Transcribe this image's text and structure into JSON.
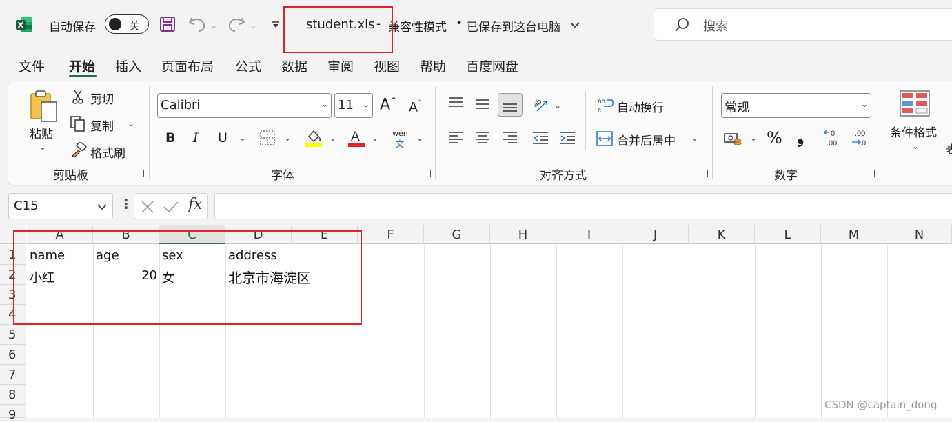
{
  "titlebar": {
    "autosave_label": "自动保存",
    "autosave_state": "关",
    "filename": "student.xls",
    "separator": "-",
    "mode": "兼容性模式",
    "save_status": "已保存到这台电脑",
    "search_placeholder": "搜索"
  },
  "menu": [
    "文件",
    "开始",
    "插入",
    "页面布局",
    "公式",
    "数据",
    "审阅",
    "视图",
    "帮助",
    "百度网盘"
  ],
  "ribbon": {
    "clipboard": {
      "paste": "粘贴",
      "cut": "剪切",
      "copy": "复制",
      "format_painter": "格式刷",
      "group": "剪贴板"
    },
    "font": {
      "name": "Calibri",
      "size": "11",
      "bold": "B",
      "italic": "I",
      "underline": "U",
      "phonetic_top": "wén",
      "phonetic_bottom": "文",
      "group": "字体"
    },
    "alignment": {
      "wrap": "自动换行",
      "merge": "合并后居中",
      "group": "对齐方式"
    },
    "number": {
      "format": "常规",
      "percent": "%",
      "comma": "❟",
      "inc_decimal": "←0\n.00",
      "group": "数字"
    },
    "styles": {
      "conditional": "条件格式",
      "partial": "表"
    }
  },
  "formula_bar": {
    "cell_ref": "C15",
    "fx": "fx",
    "value": ""
  },
  "sheet": {
    "columns": [
      "A",
      "B",
      "C",
      "D",
      "E",
      "F",
      "G",
      "H",
      "I",
      "J",
      "K",
      "L",
      "M",
      "N"
    ],
    "selected_column": "C",
    "rows": [
      "1",
      "2",
      "3",
      "4",
      "5",
      "6",
      "7",
      "8",
      "9"
    ],
    "cells": {
      "A1": "name",
      "B1": "age",
      "C1": "sex",
      "D1": "address",
      "A2": "小红",
      "B2": "20",
      "C2": "女",
      "D2": "北京市海淀区"
    }
  },
  "watermark": "CSDN @captain_dong",
  "colors": {
    "excel_green": "#1e7145",
    "annotation_red": "#e0242c",
    "accent_magenta": "#8b2e8f"
  }
}
